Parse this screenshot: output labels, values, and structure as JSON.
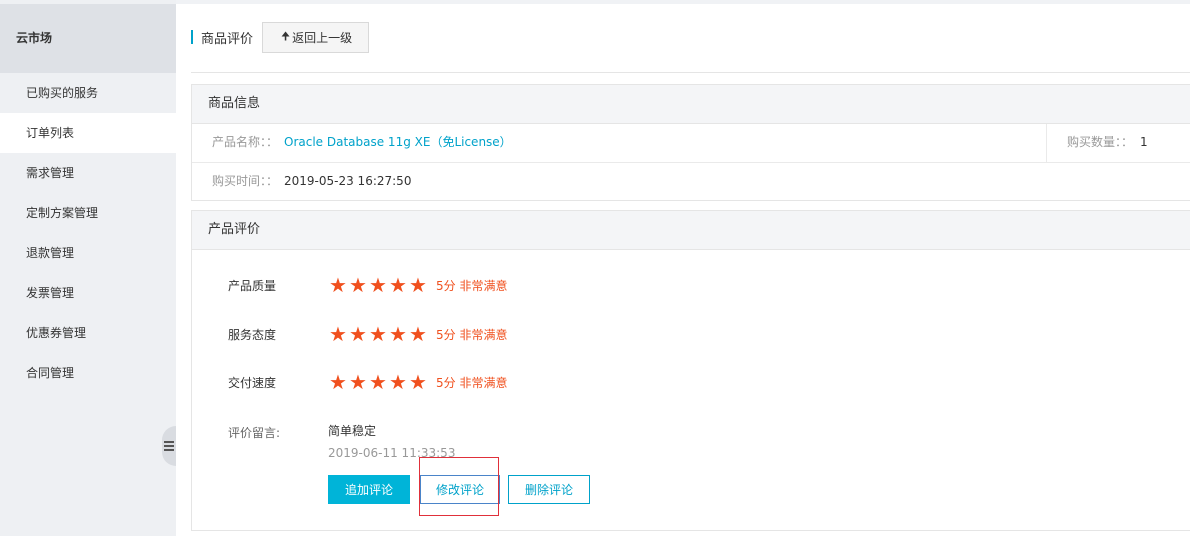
{
  "sidebar": {
    "title": "云市场",
    "items": [
      {
        "label": "已购买的服务",
        "active": false
      },
      {
        "label": "订单列表",
        "active": true
      },
      {
        "label": "需求管理",
        "active": false
      },
      {
        "label": "定制方案管理",
        "active": false
      },
      {
        "label": "退款管理",
        "active": false
      },
      {
        "label": "发票管理",
        "active": false
      },
      {
        "label": "优惠券管理",
        "active": false
      },
      {
        "label": "合同管理",
        "active": false
      }
    ]
  },
  "header": {
    "title": "商品评价",
    "back_label": "返回上一级",
    "back_icon": "arrow-up-icon"
  },
  "product_info": {
    "title": "商品信息",
    "name_label": "产品名称：：",
    "name_value": "Oracle Database 11g XE（免License）",
    "quantity_label": "购买数量：：",
    "quantity_value": "1",
    "time_label": "购买时间：：",
    "time_value": "2019-05-23 16:27:50"
  },
  "review": {
    "title": "产品评价",
    "ratings": [
      {
        "label": "产品质量",
        "stars": 5,
        "max": 5,
        "text": "5分 非常满意"
      },
      {
        "label": "服务态度",
        "stars": 5,
        "max": 5,
        "text": "5分 非常满意"
      },
      {
        "label": "交付速度",
        "stars": 5,
        "max": 5,
        "text": "5分 非常满意"
      }
    ],
    "comment_label": "评价留言:",
    "comment_text": "简单稳定",
    "comment_time": "2019-06-11 11:33:53",
    "buttons": {
      "append": "追加评论",
      "edit": "修改评论",
      "delete": "删除评论"
    }
  },
  "colors": {
    "accent": "#00a2ca",
    "star": "#f0501e",
    "primary_button": "#00b4d8",
    "highlight": "#e0303a"
  }
}
